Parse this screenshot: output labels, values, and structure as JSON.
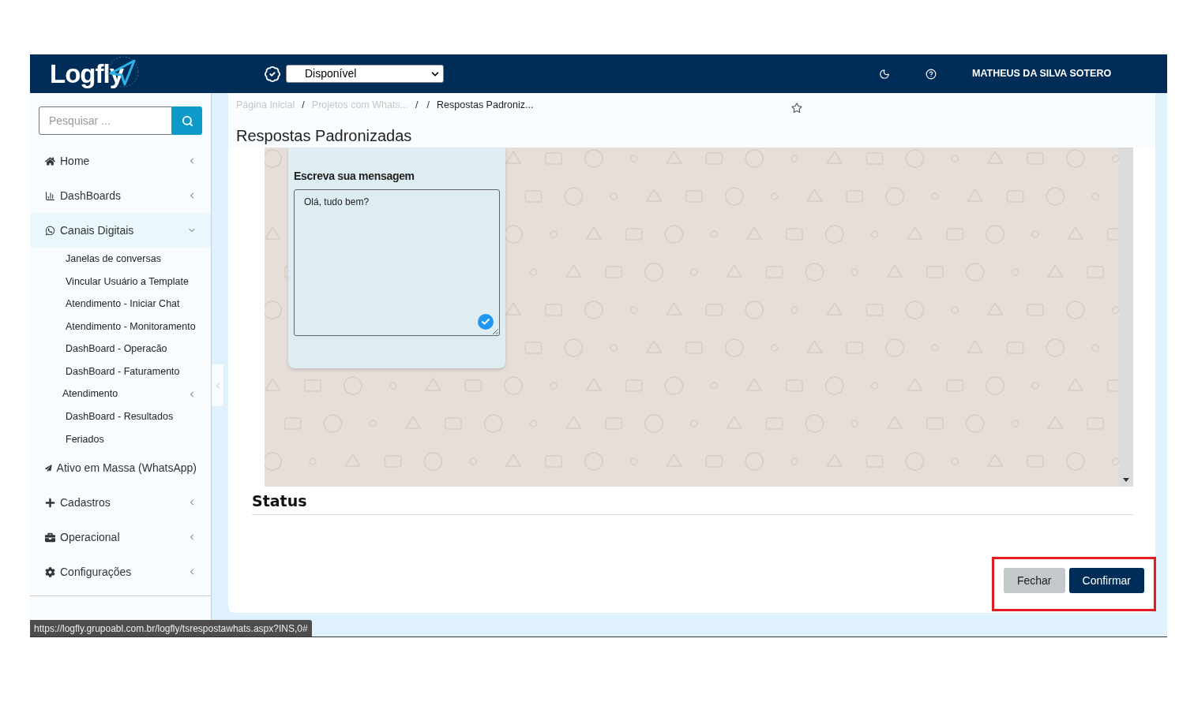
{
  "header": {
    "logo": "Logfly",
    "status_select": {
      "value": "Disponível"
    },
    "user_name": "MATHEUS DA SILVA SOTERO"
  },
  "sidebar": {
    "search": {
      "placeholder": "Pesquisar ..."
    },
    "items": [
      {
        "label": "Home",
        "expanded": false
      },
      {
        "label": "DashBoards",
        "expanded": false
      },
      {
        "label": "Canais Digitais",
        "expanded": true,
        "children": [
          {
            "label": "Janelas de conversas"
          },
          {
            "label": "Vincular Usuário a Template"
          },
          {
            "label": "Atendimento - Iniciar Chat"
          },
          {
            "label": "Atendimento - Monitoramento"
          },
          {
            "label": "DashBoard - Operacão"
          },
          {
            "label": "DashBoard - Faturamento"
          },
          {
            "label": "Atendimento",
            "expanded": false
          },
          {
            "label": "DashBoard - Resultados"
          },
          {
            "label": "Feriados"
          }
        ]
      },
      {
        "label": "Ativo em Massa (WhatsApp)"
      },
      {
        "label": "Cadastros",
        "expanded": false
      },
      {
        "label": "Operacional",
        "expanded": false
      },
      {
        "label": "Configurações",
        "expanded": false
      }
    ]
  },
  "breadcrumb": [
    {
      "kind": "link",
      "text": "Página Inicial"
    },
    {
      "kind": "separator",
      "text": "/"
    },
    {
      "kind": "link",
      "text": "Projetos com Whats..."
    },
    {
      "kind": "separator",
      "text": "/"
    },
    {
      "kind": "separator",
      "text": "/"
    },
    {
      "kind": "current",
      "text": "Respostas Padroniz..."
    }
  ],
  "page_title": "Respostas Padronizadas",
  "message_panel": {
    "label": "Escreva sua mensagem",
    "value": "Olá, tudo bem?"
  },
  "status_heading": "Status",
  "buttons": [
    {
      "kind": "secondary",
      "label": "Fechar"
    },
    {
      "kind": "primary",
      "label": "Confirmar"
    }
  ],
  "status_url": "https://logfly.grupoabl.com.br/logfly/tsrespostawhats.aspx?INS,0#"
}
